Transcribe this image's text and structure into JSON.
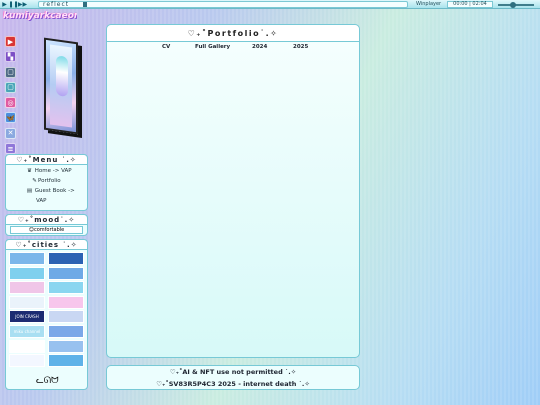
{
  "player": {
    "track_title": "reflect",
    "app_name": "Winplayer",
    "time": "00:00 | 02:04",
    "icons": [
      "play-icon",
      "pause-icon",
      "next-icon"
    ]
  },
  "logo_text": "kumiyarkcaeon",
  "social": [
    {
      "name": "youtube-icon",
      "glyph": "▶",
      "color": "#d93535"
    },
    {
      "name": "twitch-icon",
      "glyph": "▚",
      "color": "#7d4fc6"
    },
    {
      "name": "app-icon",
      "glyph": "▢",
      "color": "#4f6b86"
    },
    {
      "name": "app-icon-2",
      "glyph": "▢",
      "color": "#4aa6b8"
    },
    {
      "name": "instagram-icon",
      "glyph": "◎",
      "color": "#e05aa0"
    },
    {
      "name": "bluesky-icon",
      "glyph": "🦋",
      "color": "#4b8fe0"
    },
    {
      "name": "x-icon",
      "glyph": "✕",
      "color": "#8aa9e0"
    },
    {
      "name": "cat-icon",
      "glyph": "≡",
      "color": "#8f77d9"
    }
  ],
  "menu": {
    "title": "♡₊˚Menu ˙.✧",
    "items": [
      {
        "icon": "♛",
        "label": "Home -> VAP"
      },
      {
        "icon": "✎",
        "label": "Portfolio"
      },
      {
        "icon": "▤",
        "label": "Guest Book ->"
      },
      {
        "icon": "",
        "label": "VAP"
      }
    ]
  },
  "mood": {
    "title": "♡₊˚mood˙.✧",
    "value": "☺comfortable"
  },
  "cities": {
    "title": "♡₊˚cities ˙.✧",
    "buttons": [
      {
        "text": "",
        "color": "#7bb7ea"
      },
      {
        "text": "",
        "color": "#2b62b3"
      },
      {
        "text": "",
        "color": "#7fd0ee"
      },
      {
        "text": "",
        "color": "#6ea9e6"
      },
      {
        "text": "",
        "color": "#f0c6e8"
      },
      {
        "text": "",
        "color": "#8ad6f0"
      },
      {
        "text": "",
        "color": "#eaf3fb"
      },
      {
        "text": "",
        "color": "#f7c6ec"
      },
      {
        "text": "JOIN CRASH",
        "color": "#1c2b72"
      },
      {
        "text": "",
        "color": "#c9d7f3"
      },
      {
        "text": "miku channel",
        "color": "#a9dff2"
      },
      {
        "text": "",
        "color": "#7aa8e8"
      },
      {
        "text": "",
        "color": "#ffffff"
      },
      {
        "text": "",
        "color": "#98c1ef"
      },
      {
        "text": "",
        "color": "#f3f7ff"
      },
      {
        "text": "",
        "color": "#5fb2e8"
      }
    ]
  },
  "portfolio": {
    "title": "♡₊˚Portfolio˙.✧",
    "tabs": [
      "CV",
      "Full Gallery",
      "2024",
      "2025"
    ]
  },
  "footer": {
    "line1": "♡₊˚AI & NFT use not permitted ˙.✧",
    "line2": "♡₊˚SV83R5P4C3 2025 - internet death ˙.✧"
  }
}
